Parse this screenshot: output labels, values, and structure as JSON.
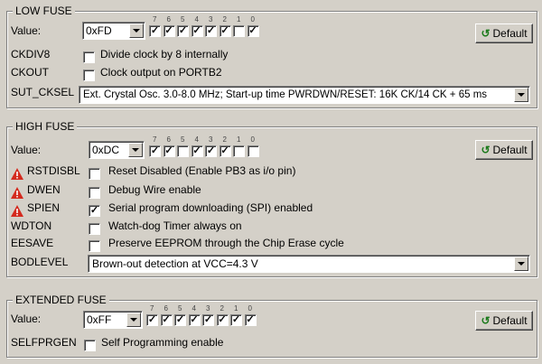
{
  "low_fuse": {
    "title": "LOW FUSE",
    "value_label": "Value:",
    "value": "0xFD",
    "bits": [
      {
        "n": "7",
        "on": true
      },
      {
        "n": "6",
        "on": true
      },
      {
        "n": "5",
        "on": true
      },
      {
        "n": "4",
        "on": true
      },
      {
        "n": "3",
        "on": true
      },
      {
        "n": "2",
        "on": true
      },
      {
        "n": "1",
        "on": false
      },
      {
        "n": "0",
        "on": true
      }
    ],
    "default_label": "Default",
    "options": [
      {
        "name": "CKDIV8",
        "desc": "Divide clock by 8 internally",
        "checked": false
      },
      {
        "name": "CKOUT",
        "desc": "Clock output on PORTB2",
        "checked": false
      }
    ],
    "sut_label": "SUT_CKSEL",
    "sut_value": "Ext. Crystal Osc. 3.0-8.0 MHz; Start-up time PWRDWN/RESET: 16K CK/14 CK + 65 ms"
  },
  "high_fuse": {
    "title": "HIGH FUSE",
    "value_label": "Value:",
    "value": "0xDC",
    "bits": [
      {
        "n": "7",
        "on": true
      },
      {
        "n": "6",
        "on": true
      },
      {
        "n": "5",
        "on": false
      },
      {
        "n": "4",
        "on": true
      },
      {
        "n": "3",
        "on": true
      },
      {
        "n": "2",
        "on": true
      },
      {
        "n": "1",
        "on": false
      },
      {
        "n": "0",
        "on": false
      }
    ],
    "default_label": "Default",
    "options": [
      {
        "name": "RSTDISBL",
        "desc": "Reset Disabled (Enable PB3 as i/o pin)",
        "checked": false,
        "warn": true
      },
      {
        "name": "DWEN",
        "desc": "Debug Wire enable",
        "checked": false,
        "warn": true
      },
      {
        "name": "SPIEN",
        "desc": "Serial program downloading (SPI) enabled",
        "checked": true,
        "warn": true
      },
      {
        "name": "WDTON",
        "desc": "Watch-dog Timer always on",
        "checked": false,
        "warn": false
      },
      {
        "name": "EESAVE",
        "desc": "Preserve EEPROM through the Chip Erase cycle",
        "checked": false,
        "warn": false
      }
    ],
    "bod_label": "BODLEVEL",
    "bod_value": "Brown-out detection at VCC=4.3 V"
  },
  "extended_fuse": {
    "title": "EXTENDED FUSE",
    "value_label": "Value:",
    "value": "0xFF",
    "bits": [
      {
        "n": "7",
        "on": true
      },
      {
        "n": "6",
        "on": true
      },
      {
        "n": "5",
        "on": true
      },
      {
        "n": "4",
        "on": true
      },
      {
        "n": "3",
        "on": true
      },
      {
        "n": "2",
        "on": true
      },
      {
        "n": "1",
        "on": true
      },
      {
        "n": "0",
        "on": true
      }
    ],
    "default_label": "Default",
    "options": [
      {
        "name": "SELFPRGEN",
        "desc": "Self Programming enable",
        "checked": false
      }
    ]
  },
  "icons": {
    "warning": "warning-icon",
    "default": "undo-arrow-icon",
    "dropdown": "chevron-down-icon"
  },
  "colors": {
    "background": "#d4d0c8",
    "warning": "#d42a1e",
    "default_icon": "#1b7a1b"
  }
}
